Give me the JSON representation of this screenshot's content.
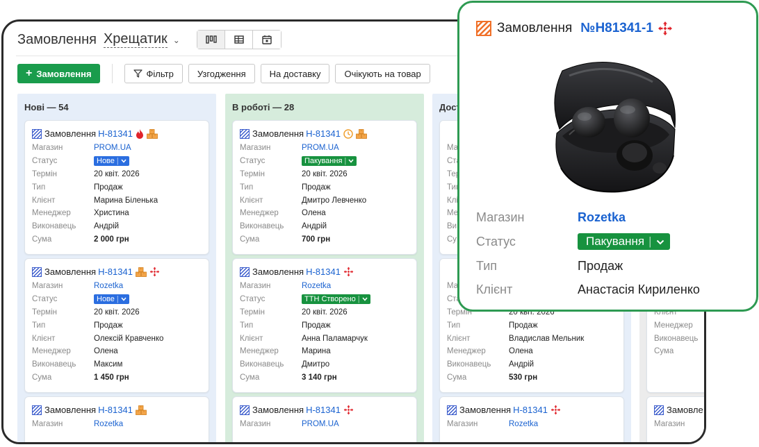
{
  "header": {
    "title": "Замовлення",
    "store": "Хрещатик",
    "views": [
      "kanban-icon",
      "table-icon",
      "calendar-icon"
    ]
  },
  "toolbar": {
    "add_label": "Замовлення",
    "filters": [
      "Фільтр",
      "Узгодження",
      "На доставку",
      "Очікують на товар"
    ]
  },
  "colors": {
    "accent": "#1a9c4c",
    "link": "#1a62d0",
    "status_new": "#2b6ee0",
    "status_work": "#17923f"
  },
  "columns": [
    {
      "title": "Нові — 54",
      "cards": [
        {
          "label": "Замовлення",
          "num": "Н-81341",
          "icons": [
            "flame-icon",
            "boxes-icon"
          ],
          "rows": [
            [
              "Магазин",
              "PROM.UA"
            ],
            [
              "Статус",
              "Нове"
            ],
            [
              "Термін",
              "20 квіт. 2026"
            ],
            [
              "Тип",
              "Продаж"
            ],
            [
              "Клієнт",
              "Марина Біленька"
            ],
            [
              "Менеджер",
              "Христина"
            ],
            [
              "Виконавець",
              "Андрій"
            ],
            [
              "Сума",
              "2 000 грн"
            ]
          ]
        },
        {
          "label": "Замовлення",
          "num": "Н-81341",
          "icons": [
            "boxes-icon",
            "nova-poshta-icon"
          ],
          "rows": [
            [
              "Магазин",
              "Rozetka"
            ],
            [
              "Статус",
              "Нове"
            ],
            [
              "Термін",
              "20 квіт. 2026"
            ],
            [
              "Тип",
              "Продаж"
            ],
            [
              "Клієнт",
              "Олексій Кравченко"
            ],
            [
              "Менеджер",
              "Олена"
            ],
            [
              "Виконавець",
              "Максим"
            ],
            [
              "Сума",
              "1 450 грн"
            ]
          ]
        },
        {
          "label": "Замовлення",
          "num": "Н-81341",
          "icons": [
            "boxes-icon"
          ],
          "rows": [
            [
              "Магазин",
              "Rozetka"
            ]
          ]
        }
      ]
    },
    {
      "title": "В роботі — 28",
      "cards": [
        {
          "label": "Замовлення",
          "num": "Н-81341",
          "icons": [
            "clock-icon",
            "boxes-icon"
          ],
          "rows": [
            [
              "Магазин",
              "PROM.UA"
            ],
            [
              "Статус",
              "Пакування"
            ],
            [
              "Термін",
              "20 квіт. 2026"
            ],
            [
              "Тип",
              "Продаж"
            ],
            [
              "Клієнт",
              "Дмитро Левченко"
            ],
            [
              "Менеджер",
              "Олена"
            ],
            [
              "Виконавець",
              "Андрій"
            ],
            [
              "Сума",
              "700 грн"
            ]
          ]
        },
        {
          "label": "Замовлення",
          "num": "Н-81341",
          "icons": [
            "nova-poshta-icon"
          ],
          "rows": [
            [
              "Магазин",
              "Rozetka"
            ],
            [
              "Статус",
              "ТТН Створено"
            ],
            [
              "Термін",
              "20 квіт. 2026"
            ],
            [
              "Тип",
              "Продаж"
            ],
            [
              "Клієнт",
              "Анна Паламарчук"
            ],
            [
              "Менеджер",
              "Марина"
            ],
            [
              "Виконавець",
              "Дмитро"
            ],
            [
              "Сума",
              "3 140 грн"
            ]
          ]
        },
        {
          "label": "Замовлення",
          "num": "Н-81341",
          "icons": [
            "nova-poshta-icon"
          ],
          "rows": [
            [
              "Магазин",
              "PROM.UA"
            ]
          ]
        }
      ]
    },
    {
      "title": "Дост",
      "cards": [
        {
          "label": "",
          "num": "",
          "icons": [],
          "rows": [
            [
              "Ма",
              ""
            ],
            [
              "Ста",
              ""
            ],
            [
              "Тер",
              ""
            ],
            [
              "Тип",
              ""
            ],
            [
              "Клі",
              ""
            ],
            [
              "Ме",
              ""
            ],
            [
              "Ви",
              ""
            ],
            [
              "Су",
              ""
            ]
          ]
        },
        {
          "label": "",
          "num": "",
          "icons": [],
          "rows": [
            [
              "Ма",
              ""
            ],
            [
              "Ста",
              ""
            ],
            [
              "Термін",
              "20 квіт. 2026"
            ],
            [
              "Тип",
              "Продаж"
            ],
            [
              "Клієнт",
              "Владислав Мельник"
            ],
            [
              "Менеджер",
              "Олена"
            ],
            [
              "Виконавець",
              "Андрій"
            ],
            [
              "Сума",
              "530 грн"
            ]
          ]
        },
        {
          "label": "Замовлення",
          "num": "Н-81341",
          "icons": [
            "nova-poshta-icon"
          ],
          "rows": [
            [
              "Магазин",
              "Rozetka"
            ]
          ]
        }
      ]
    },
    {
      "title": "",
      "cards": [
        {
          "label": "",
          "num": "",
          "icons": [],
          "rows": []
        },
        {
          "label": "",
          "num": "",
          "icons": [],
          "rows": [
            [
              "",
              ""
            ],
            [
              "Тип",
              ""
            ],
            [
              "Клієнт",
              ""
            ],
            [
              "Менеджер",
              ""
            ],
            [
              "Виконавець",
              ""
            ],
            [
              "Сума",
              ""
            ]
          ]
        },
        {
          "label": "Замовле",
          "num": "",
          "icons": [],
          "rows": [
            [
              "Магазин",
              ""
            ]
          ]
        }
      ]
    }
  ],
  "popup": {
    "label": "Замовлення",
    "num": "№Н81341-1",
    "rows": [
      {
        "k": "Магазин",
        "v": "Rozetka"
      },
      {
        "k": "Статус",
        "v": "Пакування"
      },
      {
        "k": "Тип",
        "v": "Продаж"
      },
      {
        "k": "Клієнт",
        "v": "Анастасія Кириленко"
      }
    ]
  }
}
